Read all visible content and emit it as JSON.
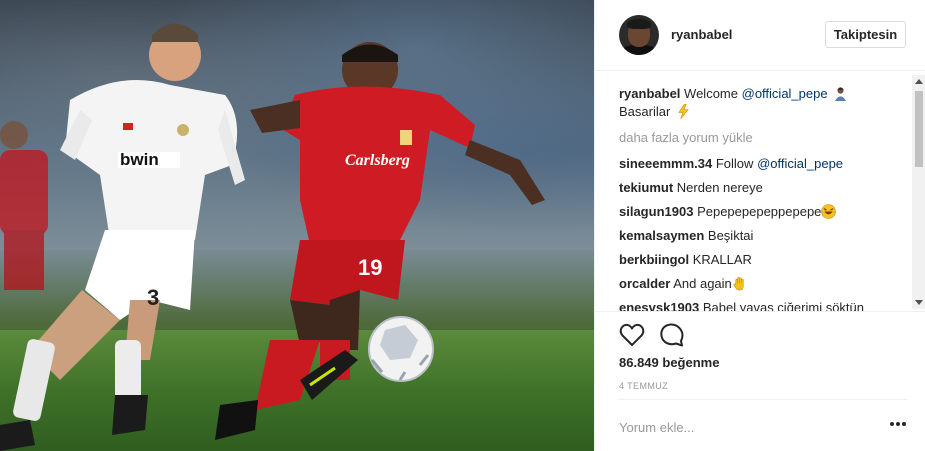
{
  "post": {
    "username": "ryanbabel",
    "follow_label": "Takiptesin",
    "caption": {
      "user": "ryanbabel",
      "text1": "Welcome",
      "mention": "@official_pepe",
      "text2": "Basarilar"
    },
    "load_more": "daha fazla yorum yükle",
    "comments": [
      {
        "user": "sineeemmm.34",
        "text": "Follow",
        "mention": "@official_pepe"
      },
      {
        "user": "tekiumut",
        "text": "Nerden nereye"
      },
      {
        "user": "silagun1903",
        "text": "Pepepepepeppepepe"
      },
      {
        "user": "kemalsaymen",
        "text": "Beşiktai"
      },
      {
        "user": "berkbiingol",
        "text": "KRALLAR"
      },
      {
        "user": "orcalder",
        "text": "And again"
      },
      {
        "user": "enesvsk1903",
        "text": "Babel yavaş ciğerimi söktün"
      }
    ],
    "likes": "86.849 beğenme",
    "date": "4 TEMMUZ",
    "comment_placeholder": "Yorum ekle..."
  },
  "photo": {
    "shirt_sponsor_left": "bwin",
    "shirt_sponsor_right": "Carlsberg",
    "number_left": "3",
    "number_right": "19"
  },
  "icons": [
    "heart-icon",
    "comment-icon",
    "more-options-icon"
  ],
  "colors": {
    "mention": "#003569",
    "muted": "#999999",
    "border": "#efefef"
  }
}
